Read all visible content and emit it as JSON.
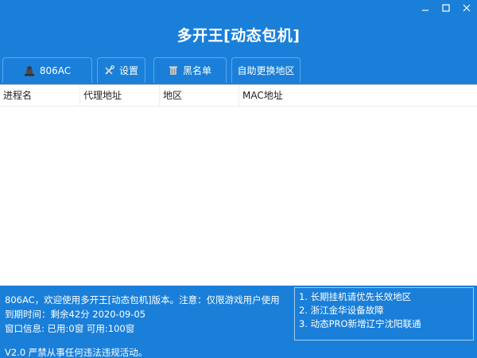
{
  "window": {
    "title": "多开王[动态包机]",
    "controls": {
      "minimize_icon": "minimize-icon",
      "maximize_icon": "maximize-icon",
      "close_icon": "close-icon"
    }
  },
  "tabs": [
    {
      "label": "806AC",
      "icon": "user-icon"
    },
    {
      "label": "设置",
      "icon": "tools-icon"
    },
    {
      "label": "黑名单",
      "icon": "trash-icon"
    },
    {
      "label": "自助更换地区",
      "icon": ""
    }
  ],
  "list": {
    "columns": [
      "进程名",
      "代理地址",
      "地区",
      "MAC地址"
    ],
    "rows": []
  },
  "footer": {
    "welcome": "806AC，欢迎使用多开王[动态包机]版本。注意：仅限游戏用户使用",
    "expiry": "到期时间：剩余42分 2020-09-05",
    "window_info": "窗口信息: 已用:0窗 可用:100窗",
    "version": "V2.0 严禁从事任何违法违规活动。"
  },
  "notices": [
    "1. 长期挂机请优先长效地区",
    "2. 浙江金华设备故障",
    "3. 动态PRO新增辽宁沈阳联通"
  ],
  "colors": {
    "background": "#1a7fd9",
    "list_background": "#ffffff",
    "text": "#ffffff"
  }
}
